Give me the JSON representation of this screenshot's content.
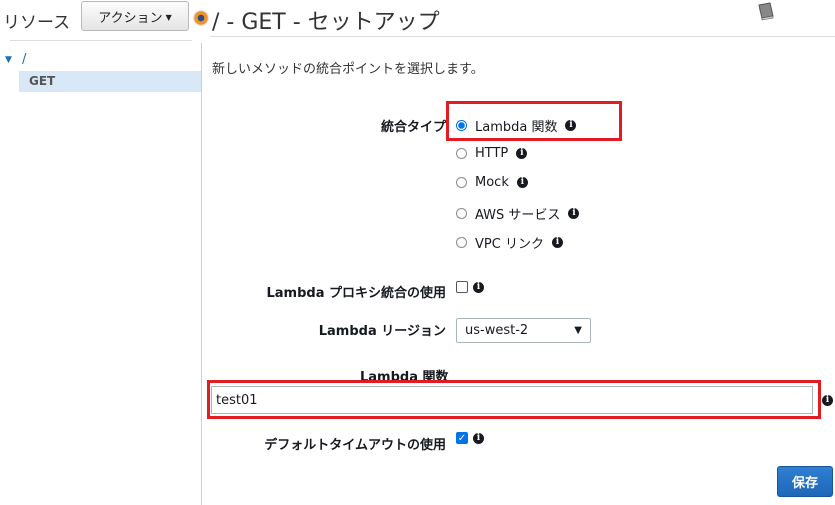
{
  "sidebar": {
    "title": "リソース",
    "actions_label": "アクション",
    "tree_root": "/",
    "tree_method": "GET"
  },
  "header": {
    "title": "/ - GET - セットアップ"
  },
  "form": {
    "description": "新しいメソッドの統合ポイントを選択します。",
    "integration_type_label": "統合タイプ",
    "integration_options": [
      {
        "label": "Lambda 関数",
        "selected": true
      },
      {
        "label": "HTTP",
        "selected": false
      },
      {
        "label": "Mock",
        "selected": false
      },
      {
        "label": "AWS サービス",
        "selected": false
      },
      {
        "label": "VPC リンク",
        "selected": false
      }
    ],
    "proxy_label": "Lambda プロキシ統合の使用",
    "proxy_checked": false,
    "region_label": "Lambda リージョン",
    "region_value": "us-west-2",
    "function_label": "Lambda 関数",
    "function_value": "test01",
    "timeout_label": "デフォルトタイムアウトの使用",
    "timeout_checked": true,
    "save_label": "保存"
  },
  "icons": {
    "info": "info-icon",
    "book": "book-icon"
  },
  "colors": {
    "highlight": "#e31b23",
    "accent": "#0073e6",
    "save_button": "#1f66b8"
  }
}
